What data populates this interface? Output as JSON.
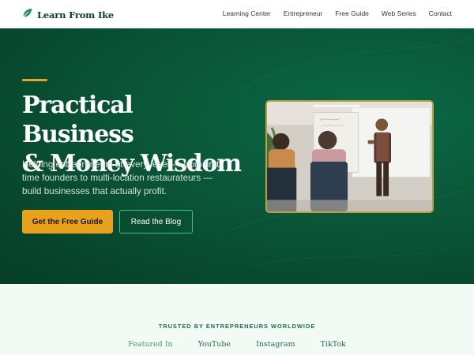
{
  "brand": {
    "name": "Learn From Ike",
    "icon": "leaf-icon",
    "color": "#0b3d26",
    "accent": "#1f8b54"
  },
  "nav": {
    "items": [
      {
        "label": "Learning Center"
      },
      {
        "label": "Entrepreneur"
      },
      {
        "label": "Free Guide"
      },
      {
        "label": "Web Series"
      },
      {
        "label": "Contact"
      }
    ]
  },
  "hero": {
    "title_line1": "Practical Business",
    "title_line2": "& Money Wisdom",
    "subtitle": "Helping entrepreneurs at every level — from first-time founders to multi-location restaurateurs — build businesses that actually profit.",
    "primary_button": "Get the Free Guide",
    "secondary_button": "Read the Blog",
    "background_color": "#0a5a3a",
    "accent_color": "#e8a21c",
    "image_alt": "Presenter speaking to seated audience"
  },
  "trusted": {
    "label": "TRUSTED BY ENTREPRENEURS WORLDWIDE",
    "platforms": [
      "Featured In",
      "YouTube",
      "Instagram",
      "TikTok"
    ]
  }
}
